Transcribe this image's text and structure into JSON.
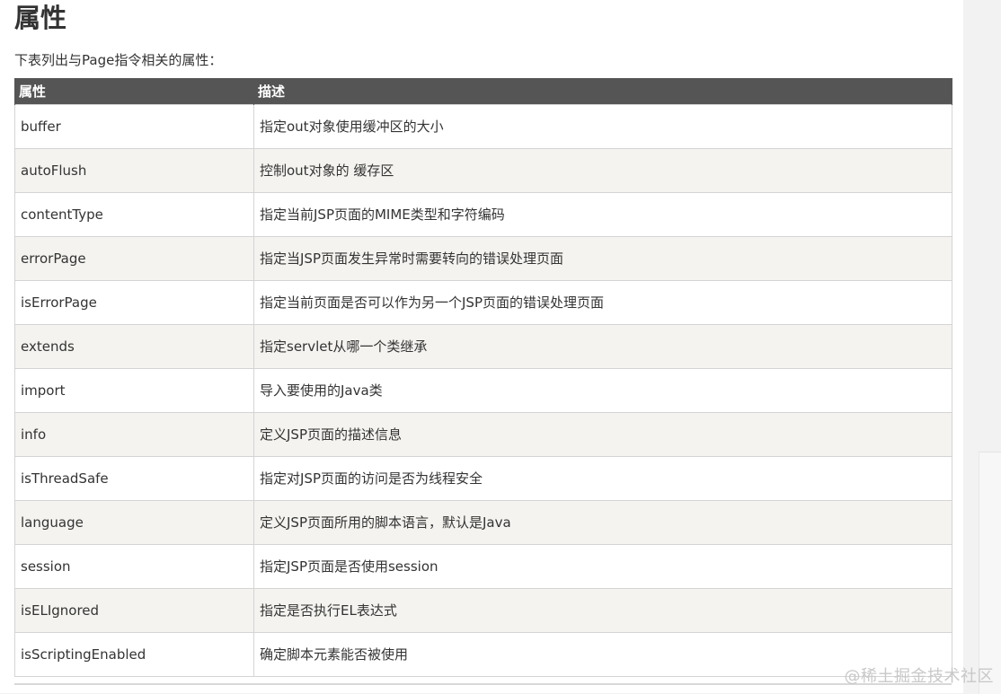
{
  "title": "属性",
  "intro": "下表列出与Page指令相关的属性：",
  "table": {
    "headers": [
      "属性",
      "描述"
    ],
    "rows": [
      {
        "name": "buffer",
        "desc": "指定out对象使用缓冲区的大小"
      },
      {
        "name": "autoFlush",
        "desc": "控制out对象的 缓存区"
      },
      {
        "name": "contentType",
        "desc": "指定当前JSP页面的MIME类型和字符编码"
      },
      {
        "name": "errorPage",
        "desc": "指定当JSP页面发生异常时需要转向的错误处理页面"
      },
      {
        "name": "isErrorPage",
        "desc": "指定当前页面是否可以作为另一个JSP页面的错误处理页面"
      },
      {
        "name": "extends",
        "desc": "指定servlet从哪一个类继承"
      },
      {
        "name": "import",
        "desc": "导入要使用的Java类"
      },
      {
        "name": "info",
        "desc": "定义JSP页面的描述信息"
      },
      {
        "name": "isThreadSafe",
        "desc": "指定对JSP页面的访问是否为线程安全"
      },
      {
        "name": "language",
        "desc": "定义JSP页面所用的脚本语言，默认是Java"
      },
      {
        "name": "session",
        "desc": "指定JSP页面是否使用session"
      },
      {
        "name": "isELIgnored",
        "desc": "指定是否执行EL表达式"
      },
      {
        "name": "isScriptingEnabled",
        "desc": "确定脚本元素能否被使用"
      }
    ]
  },
  "watermark": "@稀土掘金技术社区",
  "colors": {
    "header_bg": "#555555",
    "row_alt_bg": "#f4f3ef",
    "text": "#333333"
  }
}
